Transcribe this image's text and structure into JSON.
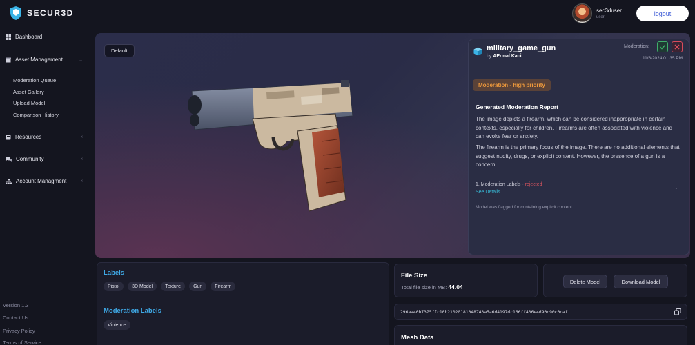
{
  "app": {
    "brand": "SECUR3D"
  },
  "user": {
    "name": "sec3duser",
    "role": "user",
    "logout_label": "logout"
  },
  "sidebar": {
    "items": [
      {
        "label": "Dashboard"
      },
      {
        "label": "Asset Management"
      },
      {
        "label": "Resources"
      },
      {
        "label": "Community"
      },
      {
        "label": "Account Managment"
      }
    ],
    "sub_items": [
      {
        "label": "Moderation Queue"
      },
      {
        "label": "Asset Gallery"
      },
      {
        "label": "Upload Model"
      },
      {
        "label": "Comparison History"
      }
    ],
    "footer": {
      "version": "Version 1.3",
      "contact": "Contact Us",
      "privacy": "Privacy Policy",
      "terms": "Terms of Service"
    }
  },
  "viewer": {
    "default_label": "Default"
  },
  "model": {
    "title": "military_game_gun",
    "by_prefix": "by",
    "author": "AErmal Kaci",
    "moderation_label": "Moderation:",
    "date": "11/6/2024 01:35 PM",
    "priority": "Moderation - high priority",
    "report_title": "Generated Moderation Report",
    "report_p1": "The image depicts a firearm, which can be considered inappropriate in certain contexts, especially for children. Firearms are often associated with violence and can evoke fear or anxiety.",
    "report_p2": "The firearm is the primary focus of the image. There are no additional elements that suggest nudity, drugs, or explicit content. However, the presence of a gun is a concern.",
    "mod_labels_text": "1. Moderation Labels -",
    "mod_labels_status": "rejected",
    "see_details": "See Details",
    "flag_note": "Model was flagged for containing explicit content."
  },
  "labels_card": {
    "title": "Labels",
    "labels": [
      "Pistol",
      "3D Model",
      "Texture",
      "Gun",
      "Firearm"
    ],
    "mod_title": "Moderation Labels",
    "mod_labels": [
      "Violence"
    ]
  },
  "file_size": {
    "title": "File Size",
    "label": "Total file size in MB:",
    "value": "44.04"
  },
  "actions": {
    "delete": "Delete Model",
    "download": "Download Model"
  },
  "hash": "296aa40b7375ffc10b21020181048743a5a6d4197dc166ff436e4d90c90c0caf",
  "mesh": {
    "title": "Mesh Data"
  },
  "colors": {
    "accent_blue": "#3fa9e6",
    "priority_orange": "#ef9a3c",
    "reject_red": "#d9545f",
    "approve_green": "#3fae6a"
  }
}
